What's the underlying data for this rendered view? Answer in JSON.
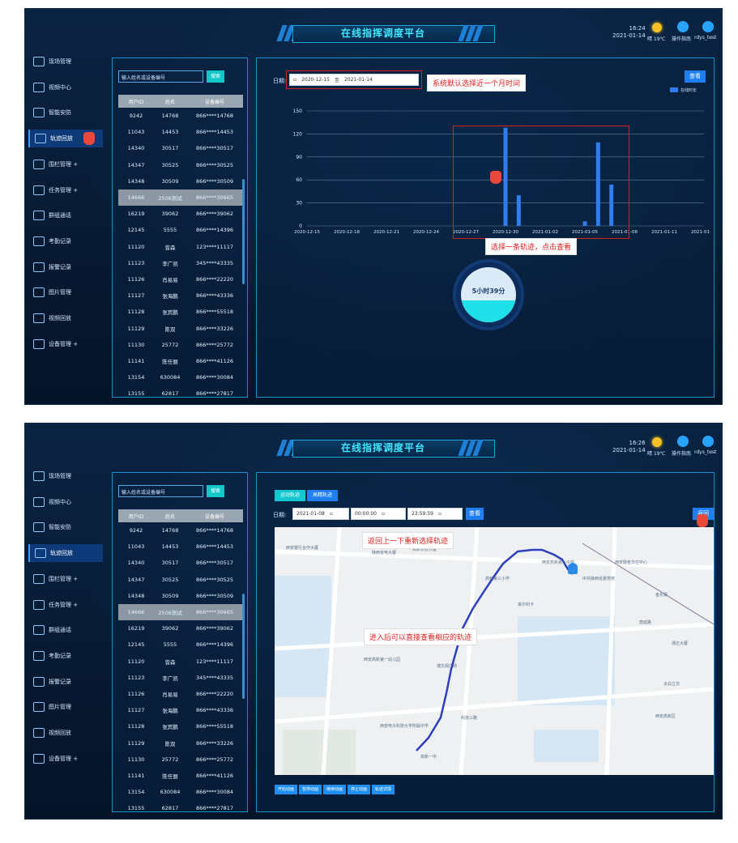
{
  "app": {
    "title": "在线指挥调度平台",
    "weather": "晴 19℃",
    "guide": "操作指南",
    "user": "rdys_test"
  },
  "nav": [
    "现场管理",
    "视频中心",
    "智能安防",
    "轨迹回放",
    "围栏管理 +",
    "任务管理 +",
    "群组通话",
    "考勤记录",
    "报警记录",
    "图片管理",
    "视频回放",
    "设备管理 +"
  ],
  "table": {
    "search_placeholder": "输入姓名或设备编号",
    "search_label": "搜索",
    "headers": [
      "用户ID",
      "姓名",
      "设备编号"
    ],
    "rows": [
      [
        "9242",
        "14768",
        "866****14768"
      ],
      [
        "11043",
        "14453",
        "866****14453"
      ],
      [
        "14340",
        "30517",
        "866****30517"
      ],
      [
        "14347",
        "30525",
        "866****30525"
      ],
      [
        "14348",
        "30509",
        "866****30509"
      ],
      [
        "14666",
        "2506测试",
        "866****30665"
      ],
      [
        "16219",
        "39062",
        "866****39062"
      ],
      [
        "12145",
        "5555",
        "866****14396"
      ],
      [
        "11120",
        "曾森",
        "123****11117"
      ],
      [
        "11123",
        "李广凯",
        "345****43335"
      ],
      [
        "11126",
        "肖易易",
        "866****22220"
      ],
      [
        "11127",
        "张海鹏",
        "866****43336"
      ],
      [
        "11128",
        "张宾鹏",
        "866****55518"
      ],
      [
        "11129",
        "陈双",
        "866****33226"
      ],
      [
        "11130",
        "25772",
        "866****25772"
      ],
      [
        "11141",
        "陈任丽",
        "866****41126"
      ],
      [
        "13154",
        "630084",
        "866****30084"
      ],
      [
        "13155",
        "62817",
        "866****27817"
      ]
    ]
  },
  "screen1": {
    "time": "16:24",
    "date": "2021-01-14",
    "date_label": "日期:",
    "date_from": "2020-12-15",
    "date_sep": "至",
    "date_to": "2021-01-14",
    "view_label": "查看",
    "legend": "在线时长",
    "callout_top": "系统默认选择近一个月时间",
    "callout_chart": "选择一条轨迹，点击查看",
    "gauge_value": "5小时39分",
    "gauge_level": 0.4
  },
  "chart_data": {
    "type": "bar",
    "x_ticks": [
      "2020-12-15",
      "2020-12-18",
      "2020-12-21",
      "2020-12-24",
      "2020-12-27",
      "2020-12-30",
      "2021-01-02",
      "2021-01-05",
      "2021-01-08",
      "2021-01-11",
      "2021-01-14"
    ],
    "y_ticks": [
      0,
      30,
      60,
      90,
      120,
      150
    ],
    "ylim": [
      0,
      150
    ],
    "series": [
      {
        "name": "在线时长",
        "x": [
          "2020-12-30",
          "2020-12-31",
          "2021-01-05",
          "2021-01-06",
          "2021-01-07"
        ],
        "values": [
          128,
          40,
          6,
          109,
          54
        ]
      }
    ],
    "legend_position": "top-right",
    "grid": true
  },
  "screen2": {
    "time": "16:26",
    "date": "2021-01-14",
    "tab_motion": "运动轨迹",
    "tab_high": "高精轨迹",
    "date_label": "日期:",
    "date_value": "2021-01-08",
    "time_from": "00:00:00",
    "time_to": "23:59:59",
    "view_label": "查看",
    "back_label": "返回",
    "callout_back": "返回上一下重新选择轨迹",
    "callout_map": "进入后可以直接查看相应的轨迹",
    "map_labels": [
      "西安银行合作大厦",
      "陕西省电大厦",
      "高新科技大厦",
      "高新第三小学",
      "来尔利卡",
      "西安高新第九中学",
      "博文阁广场",
      "西安高新第一幼儿园",
      "西安电子科技大学附属中学",
      "科技三路",
      "高新一中",
      "中共陕西省委党校",
      "西安融金华亿中心",
      "鱼化寨",
      "唐延路",
      "通达大厦",
      "太白立交",
      "西安高新区"
    ],
    "anim_buttons": [
      "开始动画",
      "暂停动画",
      "继续动画",
      "停止动画",
      "轨迹详情"
    ]
  }
}
